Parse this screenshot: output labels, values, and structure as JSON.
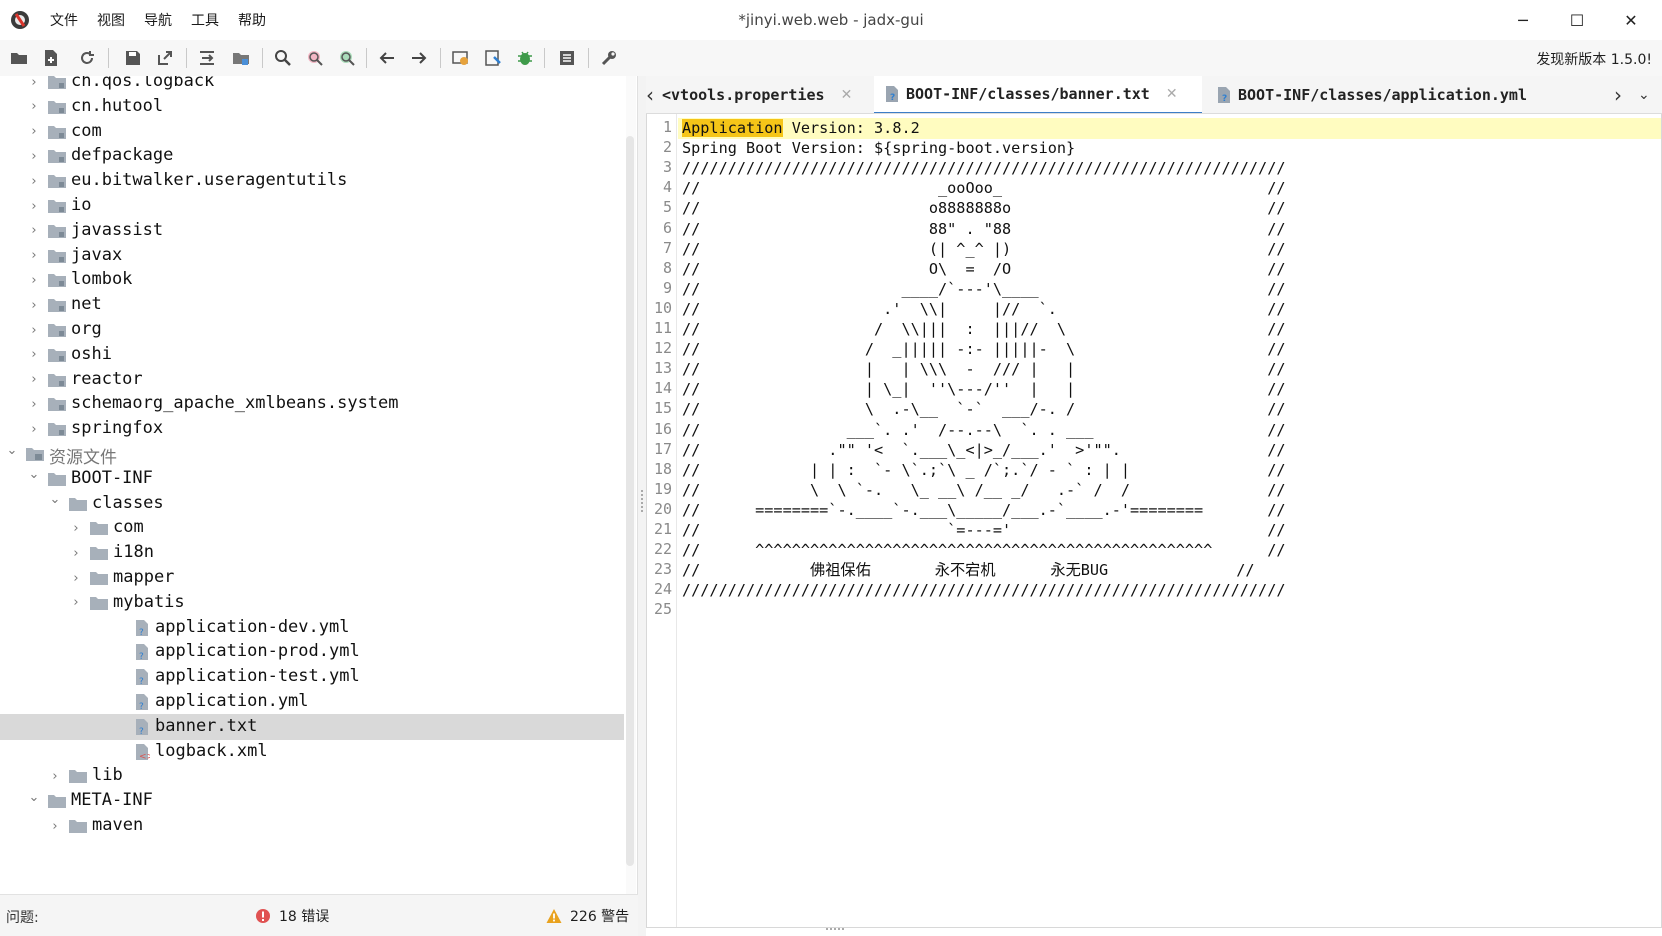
{
  "titlebar": {
    "title": "*jinyi.web.web - jadx-gui",
    "menu": [
      "文件",
      "视图",
      "导航",
      "工具",
      "帮助"
    ],
    "minimize": "─",
    "maximize": "☐",
    "close": "✕"
  },
  "toolbar": {
    "icons": [
      "open-project-icon",
      "add-files-icon",
      "sync-icon",
      "save-all-icon",
      "export-icon",
      "flatten-packages-icon",
      "sync-tree-icon",
      "search-icon",
      "find-usage-icon",
      "goto-class-icon",
      "back-arrow-icon",
      "forward-arrow-icon",
      "decompile-all-icon",
      "bookmark-icon",
      "debug-bug-icon",
      "log-viewer-icon",
      "preferences-wrench-icon"
    ],
    "update_notice": "发现新版本 1.5.0!"
  },
  "tree": {
    "items": [
      {
        "label": "ch.qos.logback",
        "type": "package",
        "indent": 0,
        "expanded": false
      },
      {
        "label": "cn.hutool",
        "type": "package",
        "indent": 0,
        "expanded": false
      },
      {
        "label": "com",
        "type": "package",
        "indent": 0,
        "expanded": false
      },
      {
        "label": "defpackage",
        "type": "package",
        "indent": 0,
        "expanded": false
      },
      {
        "label": "eu.bitwalker.useragentutils",
        "type": "package",
        "indent": 0,
        "expanded": false
      },
      {
        "label": "io",
        "type": "package",
        "indent": 0,
        "expanded": false
      },
      {
        "label": "javassist",
        "type": "package",
        "indent": 0,
        "expanded": false
      },
      {
        "label": "javax",
        "type": "package",
        "indent": 0,
        "expanded": false
      },
      {
        "label": "lombok",
        "type": "package",
        "indent": 0,
        "expanded": false
      },
      {
        "label": "net",
        "type": "package",
        "indent": 0,
        "expanded": false
      },
      {
        "label": "org",
        "type": "package",
        "indent": 0,
        "expanded": false
      },
      {
        "label": "oshi",
        "type": "package",
        "indent": 0,
        "expanded": false
      },
      {
        "label": "reactor",
        "type": "package",
        "indent": 0,
        "expanded": false
      },
      {
        "label": "schemaorg_apache_xmlbeans.system",
        "type": "package",
        "indent": 0,
        "expanded": false
      },
      {
        "label": "springfox",
        "type": "package",
        "indent": 0,
        "expanded": false
      },
      {
        "label": "资源文件",
        "type": "resources",
        "indent": -1,
        "expanded": true
      },
      {
        "label": "BOOT-INF",
        "type": "folder",
        "indent": 0,
        "expanded": true
      },
      {
        "label": "classes",
        "type": "folder",
        "indent": 1,
        "expanded": true
      },
      {
        "label": "com",
        "type": "folder",
        "indent": 2,
        "expanded": false
      },
      {
        "label": "i18n",
        "type": "folder",
        "indent": 2,
        "expanded": false
      },
      {
        "label": "mapper",
        "type": "folder",
        "indent": 2,
        "expanded": false
      },
      {
        "label": "mybatis",
        "type": "folder",
        "indent": 2,
        "expanded": false
      },
      {
        "label": "application-dev.yml",
        "type": "file",
        "indent": 2
      },
      {
        "label": "application-prod.yml",
        "type": "file",
        "indent": 2
      },
      {
        "label": "application-test.yml",
        "type": "file",
        "indent": 2
      },
      {
        "label": "application.yml",
        "type": "file",
        "indent": 2
      },
      {
        "label": "banner.txt",
        "type": "file",
        "indent": 2,
        "selected": true
      },
      {
        "label": "logback.xml",
        "type": "xmlfile",
        "indent": 2
      },
      {
        "label": "lib",
        "type": "folder",
        "indent": 1,
        "expanded": false
      },
      {
        "label": "META-INF",
        "type": "folder",
        "indent": 0,
        "expanded": true
      },
      {
        "label": "maven",
        "type": "folder",
        "indent": 1,
        "expanded": false
      }
    ]
  },
  "status": {
    "issues_label": "问题:",
    "errors": "18 错误",
    "warnings": "226 警告"
  },
  "tabs": [
    {
      "label": "evtools.properties",
      "display": "<vtools.properties",
      "active": false
    },
    {
      "label": "BOOT-INF/classes/banner.txt",
      "active": true
    },
    {
      "label": "BOOT-INF/classes/application.yml",
      "active": false
    }
  ],
  "editor": {
    "highlight_word": "Application",
    "lines": [
      " Version: 3.8.2",
      "Spring Boot Version: ${spring-boot.version}",
      "//////////////////////////////////////////////////////////////////",
      "//                          _ooOoo_                             //",
      "//                         o8888888o                            //",
      "//                         88\" . \"88                            //",
      "//                         (| ^_^ |)                            //",
      "//                         O\\  =  /O                            //",
      "//                      ____/`---'\\____                         //",
      "//                    .'  \\\\|     |//  `.                       //",
      "//                   /  \\\\|||  :  |||//  \\                      //",
      "//                  /  _||||| -:- |||||-  \\                     //",
      "//                  |   | \\\\\\  -  /// |   |                     //",
      "//                  | \\_|  ''\\---/''  |   |                     //",
      "//                  \\  .-\\__  `-`  ___/-. /                     //",
      "//                ___`. .'  /--.--\\  `. . ___                   //",
      "//              .\"\" '<  `.___\\_<|>_/___.'  >'\"\".                //",
      "//            | | :  `- \\`.;`\\ _ /`;.`/ - ` : | |               //",
      "//            \\  \\ `-.   \\_ __\\ /__ _/   .-` /  /               //",
      "//      ========`-.____`-.___\\_____/___.-`____.-'========       //",
      "//                           `=---='                            //",
      "//      ^^^^^^^^^^^^^^^^^^^^^^^^^^^^^^^^^^^^^^^^^^^^^^^^^^      //",
      "//            佛祖保佑       永不宕机      永无BUG              //",
      "//////////////////////////////////////////////////////////////////",
      ""
    ]
  }
}
